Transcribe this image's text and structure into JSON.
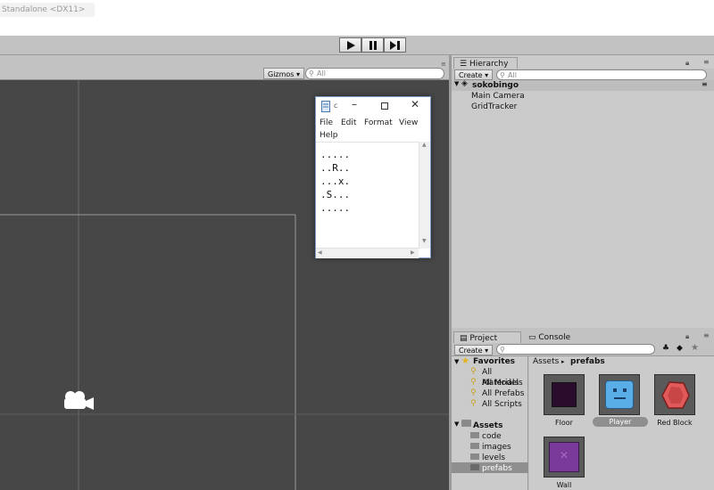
{
  "window": {
    "title": "Standalone <DX11>"
  },
  "playback": {
    "play": "play-icon",
    "pause": "pause-icon",
    "step": "step-icon"
  },
  "scene": {
    "gizmos_label": "Gizmos",
    "search_placeholder": "All"
  },
  "notepad": {
    "title": "c",
    "menu": [
      "File",
      "Edit",
      "Format",
      "View",
      "Help"
    ],
    "lines": [
      ".....",
      "..R..",
      "...x.",
      ".S...",
      "....."
    ]
  },
  "hierarchy": {
    "tab": "Hierarchy",
    "create_label": "Create",
    "search_placeholder": "All",
    "scene_name": "sokobingo",
    "items": [
      "Main Camera",
      "GridTracker"
    ]
  },
  "project": {
    "tab": "Project",
    "console_tab": "Console",
    "create_label": "Create",
    "breadcrumb": {
      "root": "Assets",
      "current": "prefabs"
    },
    "favorites": {
      "label": "Favorites",
      "items": [
        "All Materials",
        "All Models",
        "All Prefabs",
        "All Scripts"
      ]
    },
    "assets": {
      "label": "Assets",
      "folders": [
        "code",
        "images",
        "levels",
        "prefabs"
      ]
    },
    "asset_items": [
      {
        "label": "Floor",
        "color": "#2a0d2c",
        "icon": "floor-prefab-icon"
      },
      {
        "label": "Player",
        "color": "#5aaee8",
        "icon": "player-prefab-icon"
      },
      {
        "label": "Red Block",
        "color": "#e05a5a",
        "icon": "red-block-prefab-icon"
      },
      {
        "label": "Wall",
        "color": "#7a3a9a",
        "icon": "wall-prefab-icon"
      }
    ]
  },
  "colors": {
    "scene_bg": "#474747",
    "panel_bg": "#c2c2c2",
    "selection": "#3d7bd6"
  }
}
